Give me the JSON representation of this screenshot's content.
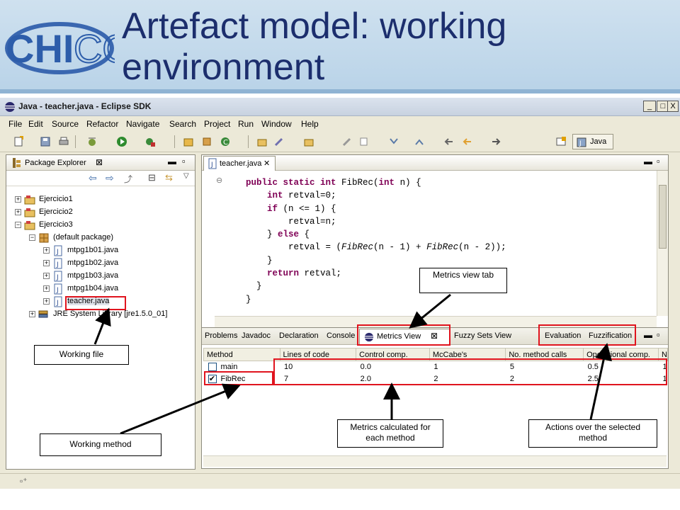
{
  "slide": {
    "title_line1": "Artefact model: working",
    "title_line2": "environment",
    "logo_text": "CHICO"
  },
  "window": {
    "title": "Java - teacher.java - Eclipse SDK",
    "min_label": "_",
    "max_label": "□",
    "close_label": "X"
  },
  "menu": [
    "File",
    "Edit",
    "Source",
    "Refactor",
    "Navigate",
    "Search",
    "Project",
    "Run",
    "Window",
    "Help"
  ],
  "toolbar": {
    "perspective_label": "Java"
  },
  "package_explorer": {
    "tab_label": "Package Explorer",
    "tree": [
      {
        "label": "Ejercicio1",
        "expander": "+"
      },
      {
        "label": "Ejercicio2",
        "expander": "+"
      },
      {
        "label": "Ejercicio3",
        "expander": "−"
      },
      {
        "label": "(default package)",
        "expander": "−"
      },
      {
        "label": "mtpg1b01.java",
        "expander": "+"
      },
      {
        "label": "mtpg1b02.java",
        "expander": "+"
      },
      {
        "label": "mtpg1b03.java",
        "expander": "+"
      },
      {
        "label": "mtpg1b04.java",
        "expander": "+"
      },
      {
        "label": "teacher.java",
        "expander": "+"
      },
      {
        "label": "JRE System Library [jre1.5.0_01]",
        "expander": "+"
      }
    ]
  },
  "editor": {
    "tab_label": "teacher.java",
    "code": [
      "public static int FibRec(int n) {",
      "    int retval=0;",
      "    if (n <= 1) {",
      "        retval=n;",
      "    } else {",
      "        retval = (FibRec(n - 1) + FibRec(n - 2));",
      "    }",
      "    return retval;",
      "  }",
      "}"
    ]
  },
  "views": {
    "tabs": [
      "Problems",
      "Javadoc",
      "Declaration",
      "Console"
    ],
    "metrics_tab": "Metrics View",
    "fuzzy_tab": "Fuzzy Sets View",
    "actions": [
      "Evaluation",
      "Fuzzification"
    ],
    "columns": [
      "Method",
      "Lines of code",
      "Control comp.",
      "McCabe's",
      "No. method calls",
      "Operational comp.",
      "N"
    ],
    "rows": [
      {
        "checked": false,
        "cells": [
          "main",
          "10",
          "0.0",
          "1",
          "5",
          "0.5",
          "1"
        ]
      },
      {
        "checked": true,
        "cells": [
          "FibRec",
          "7",
          "2.0",
          "2",
          "2",
          "2.5",
          "1"
        ]
      }
    ]
  },
  "annotations": {
    "metrics_view_tab": "Metrics view tab",
    "working_file": "Working file",
    "working_method": "Working method",
    "metrics_calculated_line1": "Metrics calculated for",
    "metrics_calculated_line2": "each method",
    "actions_line1": "Actions over the selected",
    "actions_line2": "method"
  },
  "colors": {
    "title": "#1c2e6d",
    "highlight": "#e0141e",
    "keyword": "#7f0055"
  }
}
